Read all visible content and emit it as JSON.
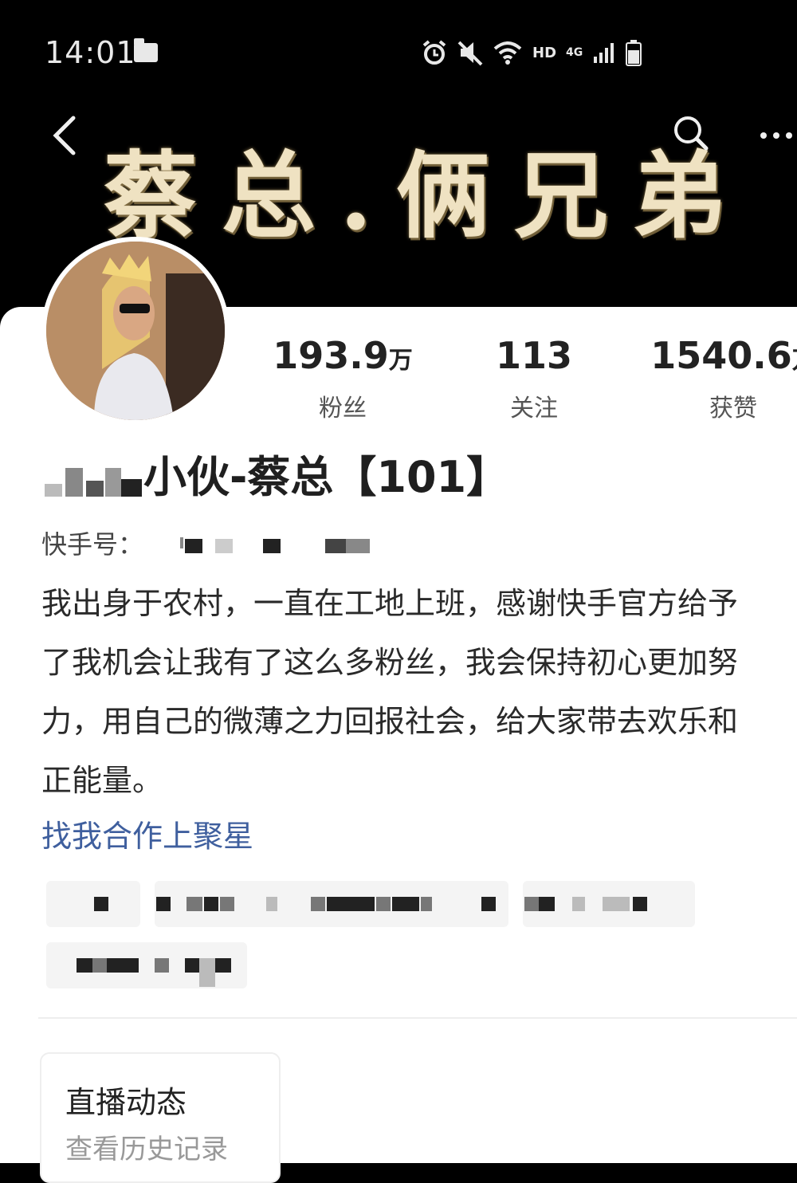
{
  "status_bar": {
    "time": "14:01",
    "hd_label": "HD",
    "network_label": "4G",
    "icons": [
      "folder-icon",
      "alarm-icon",
      "mute-icon",
      "wifi-icon",
      "signal-icon",
      "battery-icon"
    ]
  },
  "header": {
    "banner_title": "蔡总.俩兄弟",
    "icons": [
      "back-icon",
      "search-icon",
      "more-icon"
    ]
  },
  "profile": {
    "stats": [
      {
        "value": "193.9",
        "unit": "万",
        "label": "粉丝"
      },
      {
        "value": "113",
        "unit": "",
        "label": "关注"
      },
      {
        "value": "1540.6",
        "unit": "万",
        "label": "获赞"
      }
    ],
    "nickname": "小伙-蔡总【101】",
    "kuaishou_id_label": "快手号：",
    "bio": "我出身于农村，一直在工地上班，感谢快手官方给予\n了我机会让我有了这么多粉丝，我会保持初心更加努\n力，用自己的微薄之力回报社会，给大家带去欢乐和\n正能量。",
    "bio_link": "找我合作上聚星"
  },
  "live_card": {
    "title": "直播动态",
    "subtitle": "查看历史记录"
  },
  "colors": {
    "banner_bg": "#000000",
    "banner_text": "#efe2c2",
    "link": "#3f5f9e",
    "card_bg": "#ffffff"
  }
}
